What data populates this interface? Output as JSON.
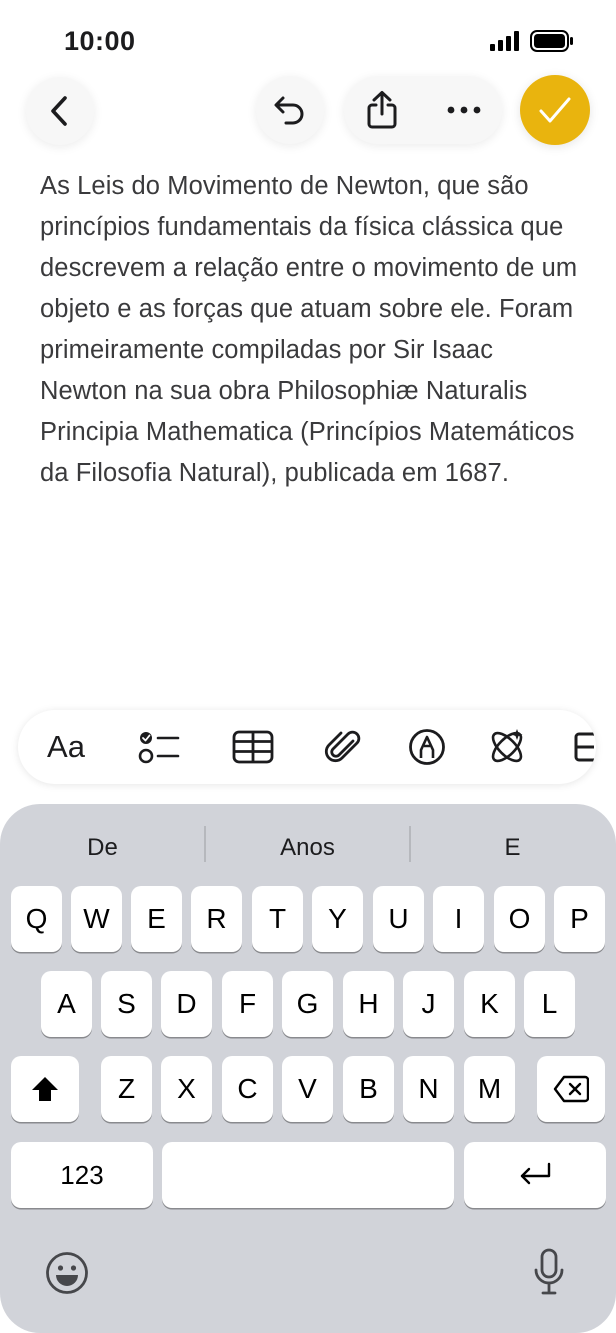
{
  "status_bar": {
    "time": "10:00"
  },
  "note": {
    "text": "As Leis do Movimento de Newton, que são princípios fundamentais da física clássica que descrevem a relação entre o movimento de um objeto e as forças que atuam sobre ele. Foram primeiramente compiladas por Sir Isaac Newton na sua obra Philosophiæ Naturalis Principia Mathematica (Princípios Matemáticos da Filosofia Natural), publicada em 1687."
  },
  "toolbar": {
    "done_color": "#e9b40e",
    "icons": [
      "back-icon",
      "undo-icon",
      "share-icon",
      "more-icon",
      "checkmark-icon"
    ]
  },
  "format_bar": {
    "text_style_label": "Aa",
    "icons": [
      "checklist-icon",
      "table-icon",
      "attachment-icon",
      "markup-icon",
      "apple-intelligence-icon"
    ]
  },
  "keyboard": {
    "suggestions": [
      "De",
      "Anos",
      "E"
    ],
    "row1": [
      "Q",
      "W",
      "E",
      "R",
      "T",
      "Y",
      "U",
      "I",
      "O",
      "P"
    ],
    "row2": [
      "A",
      "S",
      "D",
      "F",
      "G",
      "H",
      "J",
      "K",
      "L"
    ],
    "row3": [
      "Z",
      "X",
      "C",
      "V",
      "B",
      "N",
      "M"
    ],
    "numbers_label": "123"
  }
}
